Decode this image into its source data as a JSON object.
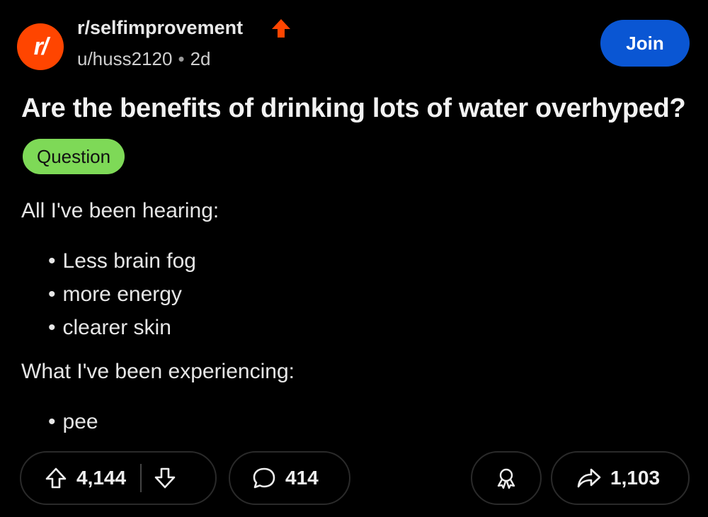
{
  "post": {
    "subreddit_icon_text": "r/",
    "subreddit": "r/selfimprovement",
    "author": "u/huss2120",
    "separator": "•",
    "age": "2d",
    "join_label": "Join",
    "title": "Are the benefits of drinking lots of water overhyped?",
    "flair": "Question",
    "body": {
      "intro": "All I've been hearing:",
      "hearing_items": [
        "Less brain fog",
        "more energy",
        "clearer skin"
      ],
      "experience_intro": "What I've been experiencing:",
      "experience_items": [
        "pee"
      ]
    }
  },
  "actions": {
    "upvotes": "4,144",
    "comments": "414",
    "shares": "1,103"
  },
  "colors": {
    "accent_orange": "#ff4500",
    "join_blue": "#0a56d3",
    "flair_green": "#7ed957"
  }
}
